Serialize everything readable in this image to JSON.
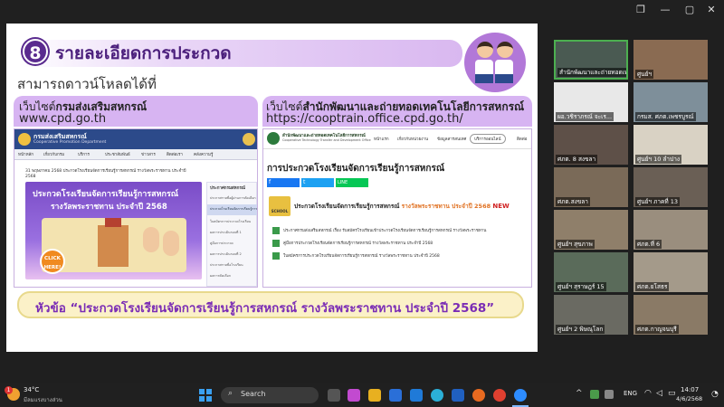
{
  "window": {
    "restore_glyph": "❐",
    "min_glyph": "—",
    "max_glyph": "▢",
    "close_glyph": "✕"
  },
  "slide": {
    "number": "8",
    "title": "รายละเอียดการประกวด",
    "subtitle": "สามารถดาวน์โหลดได้ที่",
    "left_site": {
      "prefix": "เว็บไซต์",
      "name": "กรมส่งเสริมสหกรณ์",
      "url": "www.cpd.go.th"
    },
    "right_site": {
      "prefix": "เว็บไซต์",
      "name": "สำนักพัฒนาและถ่ายทอดเทคโนโลยีการสหกรณ์",
      "url": "https://cooptrain.office.cpd.go.th/"
    },
    "left_shot": {
      "logo_text": "กรมส่งเสริมสหกรณ์",
      "logo_sub": "Cooperative Promotion Department",
      "nav": [
        "หน้าหลัก",
        "เกี่ยวกับกรม",
        "บริการ",
        "ประชาสัมพันธ์",
        "ข่าวสาร",
        "ติดต่อเรา",
        "คลังความรู้"
      ],
      "date_line": "31 พฤษภาคม 2568 ประกวดโรงเรียนจัดการเรียนรู้การสหกรณ์ รางวัลพระราชทาน ประจำปี",
      "year": "2568",
      "banner_line1": "ประกวดโรงเรียนจัดการเรียนรู้การสหกรณ์",
      "banner_line2": "รางวัลพระราชทาน ประจำปี 2568",
      "click": "CLICK HERE!",
      "side_header": "ประกาศกรมสหกรณ์",
      "side_items": [
        "ประกาศรายชื่อผู้ผ่านการคัดเลือก",
        "ประกวดโรงเรียนจัดการเรียนรู้การสหกรณ์",
        "ใบสมัครการประกวดโรงเรียน",
        "ผลการประเมินรอบที่ 1",
        "คู่มือการประกวด",
        "ผลการประเมินรอบที่ 2",
        "ประกาศรายชื่อโรงเรียน",
        "ผลการคัดเลือก"
      ]
    },
    "right_shot": {
      "org_name": "สำนักพัฒนาและถ่ายทอดเทคโนโลยีการสหกรณ์",
      "org_sub": "Cooperative Technology Transfer and Development Office",
      "nav": [
        "หน้าแรก",
        "เกี่ยวกับหน่วยงาน",
        "ข้อมูลสารสนเทศ",
        "บริการออนไลน์",
        "ติดต่อ"
      ],
      "heading": "การประกวดโรงเรียนจัดการเรียนรู้การสหกรณ์",
      "share_fb": "f",
      "share_tw": "t",
      "share_line": "LINE",
      "school_badge": "SCHOOL",
      "feature_prefix": "ประกวดโรงเรียนจัดการเรียนรู้การสหกรณ์",
      "feature_highlight": "รางวัลพระราชทาน ประจำปี 2568",
      "new_badge": "NEW",
      "docs": [
        "ประกาศกรมส่งเสริมสหกรณ์ เรื่อง รับสมัครโรงเรียนเข้าประกวดโรงเรียนจัดการเรียนรู้การสหกรณ์ รางวัลพระราชทาน",
        "คู่มือการประกวดโรงเรียนจัดการเรียนรู้การสหกรณ์ รางวัลพระราชทาน ประจำปี 2568",
        "ใบสมัครการประกวดโรงเรียนจัดการเรียนรู้การสหกรณ์ รางวัลพระราชทาน ประจำปี 2568"
      ]
    },
    "banner_text": "หัวข้อ “ประกวดโรงเรียนจัดการเรียนรู้การสหกรณ์ รางวัลพระราชทาน ประจำปี 2568”"
  },
  "gallery": {
    "tiles": [
      {
        "name": "สำนักพัฒนาและถ่ายทอดเทค",
        "bg": "#4a5a52"
      },
      {
        "name": "ศูนย์ฯ",
        "bg": "#8a6b52"
      },
      {
        "name": "ผอ.วชิราภรณ์ จะเร...",
        "bg": "#e8e8e8"
      },
      {
        "name": "ผอ.วชิราภรณ์ จะเร...",
        "bg": "#6b6f70"
      },
      {
        "name": "กรมส. ศภต.เพชรบูรณ์",
        "bg": "#7e8f9a"
      },
      {
        "name": "ศภต. 8 สงขลา",
        "bg": "#5e5048"
      },
      {
        "name": "ศูนย์ฯ 10 ลำปาง",
        "bg": "#d9d2c4"
      },
      {
        "name": "ศภต.สงขลา",
        "bg": "#7a6a58"
      },
      {
        "name": "ศูนย์ฯ ภาคที่ 13",
        "bg": "#6a5f55"
      },
      {
        "name": "ศูนย์ฯ สุขภาพ",
        "bg": "#8f7f6a"
      },
      {
        "name": "ศภต.ที่ 6",
        "bg": "#9a8e7e"
      },
      {
        "name": "ศูนย์ฯ พะเยา",
        "bg": "#c8c2b8"
      },
      {
        "name": "ศูนย์ฯ สุราษฎร์ 15",
        "bg": "#5a6b5a"
      },
      {
        "name": "ศภต.ยโสธร",
        "bg": "#a49a8a"
      },
      {
        "name": "ศูนย์ฯ 2 พิษณุโลก",
        "bg": "#6a6a62"
      },
      {
        "name": "ศภต.กาญจนบุรี",
        "bg": "#8a7a66"
      }
    ]
  },
  "taskbar": {
    "weather_temp": "34°C",
    "weather_desc": "มีลมแรงบางส่วน",
    "search_placeholder": "Search",
    "lang": "ENG",
    "time": "14:07",
    "date": "4/6/2568",
    "notif_count": "1"
  },
  "colors": {
    "purple": "#5a2b8f",
    "pill": "#d7b4f2",
    "banner_text": "#7a2cb5"
  }
}
